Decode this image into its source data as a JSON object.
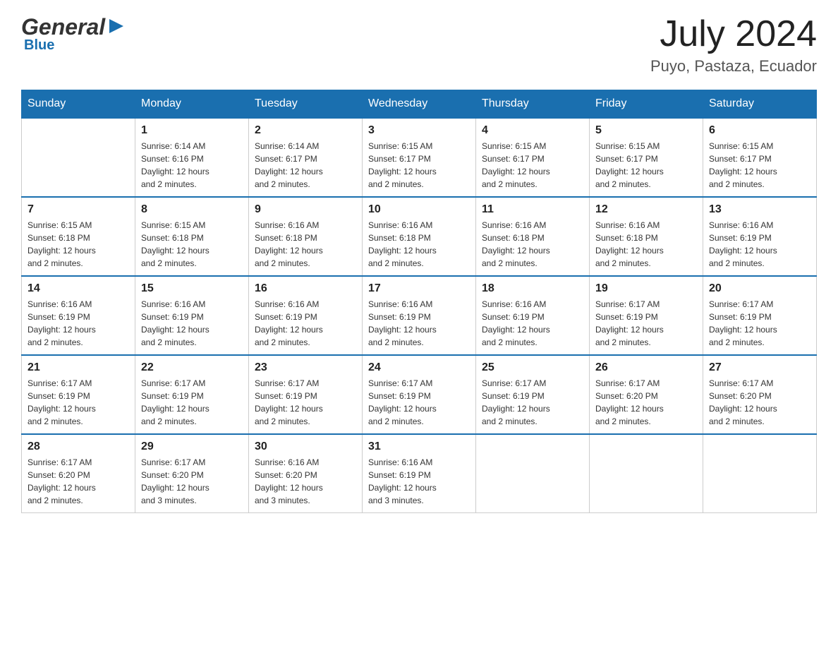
{
  "header": {
    "logo_text_black": "General",
    "logo_text_blue": "Blue",
    "month_year": "July 2024",
    "location": "Puyo, Pastaza, Ecuador"
  },
  "days_of_week": [
    "Sunday",
    "Monday",
    "Tuesday",
    "Wednesday",
    "Thursday",
    "Friday",
    "Saturday"
  ],
  "weeks": [
    [
      {
        "day": "",
        "info": ""
      },
      {
        "day": "1",
        "info": "Sunrise: 6:14 AM\nSunset: 6:16 PM\nDaylight: 12 hours\nand 2 minutes."
      },
      {
        "day": "2",
        "info": "Sunrise: 6:14 AM\nSunset: 6:17 PM\nDaylight: 12 hours\nand 2 minutes."
      },
      {
        "day": "3",
        "info": "Sunrise: 6:15 AM\nSunset: 6:17 PM\nDaylight: 12 hours\nand 2 minutes."
      },
      {
        "day": "4",
        "info": "Sunrise: 6:15 AM\nSunset: 6:17 PM\nDaylight: 12 hours\nand 2 minutes."
      },
      {
        "day": "5",
        "info": "Sunrise: 6:15 AM\nSunset: 6:17 PM\nDaylight: 12 hours\nand 2 minutes."
      },
      {
        "day": "6",
        "info": "Sunrise: 6:15 AM\nSunset: 6:17 PM\nDaylight: 12 hours\nand 2 minutes."
      }
    ],
    [
      {
        "day": "7",
        "info": "Sunrise: 6:15 AM\nSunset: 6:18 PM\nDaylight: 12 hours\nand 2 minutes."
      },
      {
        "day": "8",
        "info": "Sunrise: 6:15 AM\nSunset: 6:18 PM\nDaylight: 12 hours\nand 2 minutes."
      },
      {
        "day": "9",
        "info": "Sunrise: 6:16 AM\nSunset: 6:18 PM\nDaylight: 12 hours\nand 2 minutes."
      },
      {
        "day": "10",
        "info": "Sunrise: 6:16 AM\nSunset: 6:18 PM\nDaylight: 12 hours\nand 2 minutes."
      },
      {
        "day": "11",
        "info": "Sunrise: 6:16 AM\nSunset: 6:18 PM\nDaylight: 12 hours\nand 2 minutes."
      },
      {
        "day": "12",
        "info": "Sunrise: 6:16 AM\nSunset: 6:18 PM\nDaylight: 12 hours\nand 2 minutes."
      },
      {
        "day": "13",
        "info": "Sunrise: 6:16 AM\nSunset: 6:19 PM\nDaylight: 12 hours\nand 2 minutes."
      }
    ],
    [
      {
        "day": "14",
        "info": "Sunrise: 6:16 AM\nSunset: 6:19 PM\nDaylight: 12 hours\nand 2 minutes."
      },
      {
        "day": "15",
        "info": "Sunrise: 6:16 AM\nSunset: 6:19 PM\nDaylight: 12 hours\nand 2 minutes."
      },
      {
        "day": "16",
        "info": "Sunrise: 6:16 AM\nSunset: 6:19 PM\nDaylight: 12 hours\nand 2 minutes."
      },
      {
        "day": "17",
        "info": "Sunrise: 6:16 AM\nSunset: 6:19 PM\nDaylight: 12 hours\nand 2 minutes."
      },
      {
        "day": "18",
        "info": "Sunrise: 6:16 AM\nSunset: 6:19 PM\nDaylight: 12 hours\nand 2 minutes."
      },
      {
        "day": "19",
        "info": "Sunrise: 6:17 AM\nSunset: 6:19 PM\nDaylight: 12 hours\nand 2 minutes."
      },
      {
        "day": "20",
        "info": "Sunrise: 6:17 AM\nSunset: 6:19 PM\nDaylight: 12 hours\nand 2 minutes."
      }
    ],
    [
      {
        "day": "21",
        "info": "Sunrise: 6:17 AM\nSunset: 6:19 PM\nDaylight: 12 hours\nand 2 minutes."
      },
      {
        "day": "22",
        "info": "Sunrise: 6:17 AM\nSunset: 6:19 PM\nDaylight: 12 hours\nand 2 minutes."
      },
      {
        "day": "23",
        "info": "Sunrise: 6:17 AM\nSunset: 6:19 PM\nDaylight: 12 hours\nand 2 minutes."
      },
      {
        "day": "24",
        "info": "Sunrise: 6:17 AM\nSunset: 6:19 PM\nDaylight: 12 hours\nand 2 minutes."
      },
      {
        "day": "25",
        "info": "Sunrise: 6:17 AM\nSunset: 6:19 PM\nDaylight: 12 hours\nand 2 minutes."
      },
      {
        "day": "26",
        "info": "Sunrise: 6:17 AM\nSunset: 6:20 PM\nDaylight: 12 hours\nand 2 minutes."
      },
      {
        "day": "27",
        "info": "Sunrise: 6:17 AM\nSunset: 6:20 PM\nDaylight: 12 hours\nand 2 minutes."
      }
    ],
    [
      {
        "day": "28",
        "info": "Sunrise: 6:17 AM\nSunset: 6:20 PM\nDaylight: 12 hours\nand 2 minutes."
      },
      {
        "day": "29",
        "info": "Sunrise: 6:17 AM\nSunset: 6:20 PM\nDaylight: 12 hours\nand 3 minutes."
      },
      {
        "day": "30",
        "info": "Sunrise: 6:16 AM\nSunset: 6:20 PM\nDaylight: 12 hours\nand 3 minutes."
      },
      {
        "day": "31",
        "info": "Sunrise: 6:16 AM\nSunset: 6:19 PM\nDaylight: 12 hours\nand 3 minutes."
      },
      {
        "day": "",
        "info": ""
      },
      {
        "day": "",
        "info": ""
      },
      {
        "day": "",
        "info": ""
      }
    ]
  ]
}
